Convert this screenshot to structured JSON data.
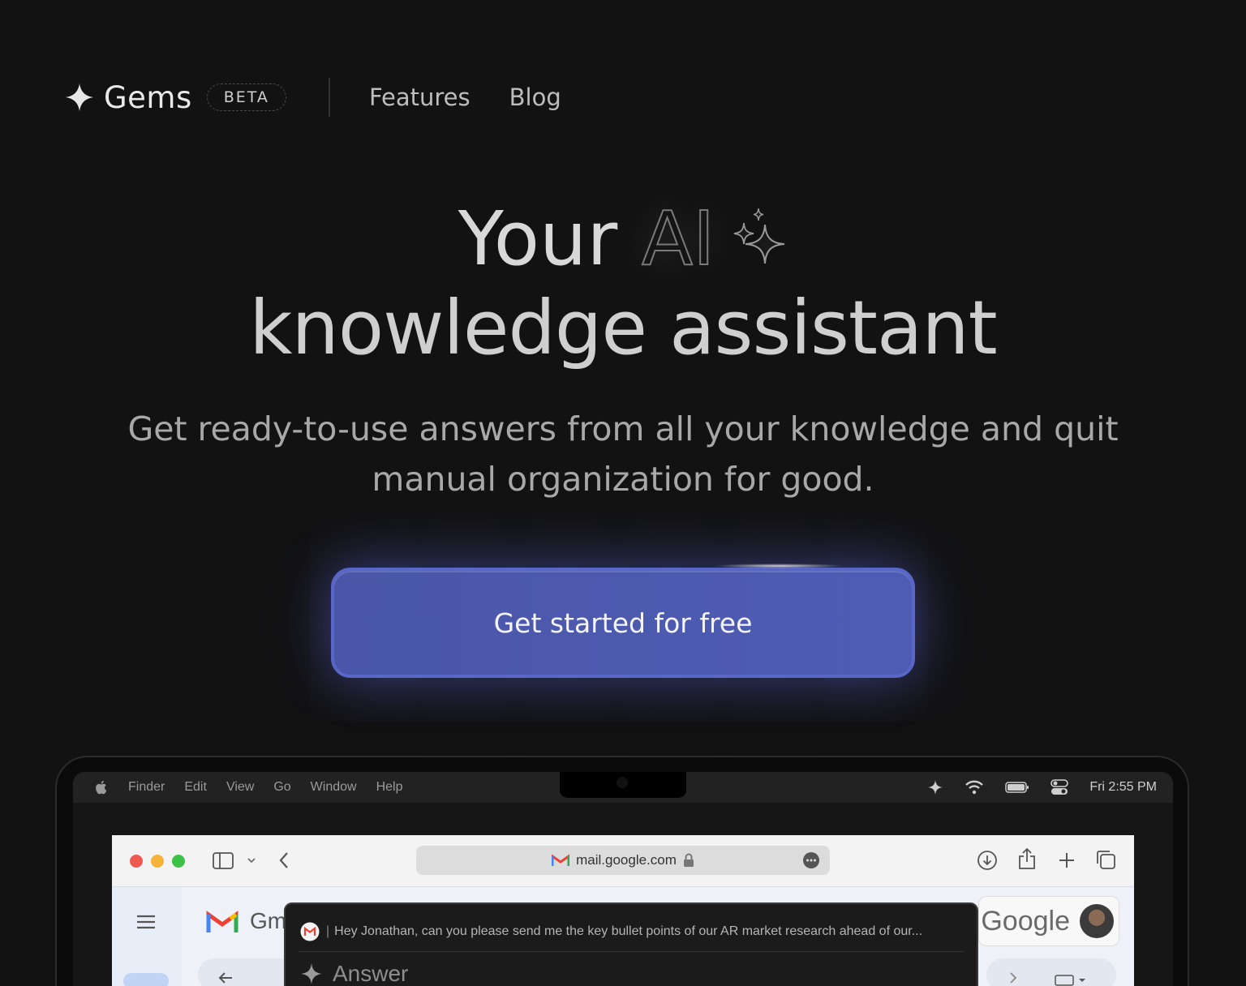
{
  "nav": {
    "brand": "Gems",
    "badge": "BETA",
    "links": [
      {
        "label": "Features"
      },
      {
        "label": "Blog"
      }
    ]
  },
  "hero": {
    "line1_word": "Your",
    "line1_ai": "AI",
    "line2": "knowledge assistant",
    "subtitle_line1": "Get ready-to-use answers from all your knowledge and quit",
    "subtitle_line2": "manual organization for good.",
    "cta_label": "Get started for free"
  },
  "colors": {
    "background": "#121212",
    "cta": "#4e5cb4",
    "cta_border": "#5866c8"
  },
  "mac_menubar": {
    "items": [
      "Finder",
      "Edit",
      "View",
      "Go",
      "Window",
      "Help"
    ],
    "clock": "Fri 2:55 PM"
  },
  "browser": {
    "url": "mail.google.com",
    "gmail_partial_label": "Gm",
    "google_label": "Google"
  },
  "assistant_popup": {
    "query": "Hey Jonathan, can you please send me the key bullet points of our AR market research ahead of our...",
    "answer_label": "Answer"
  }
}
